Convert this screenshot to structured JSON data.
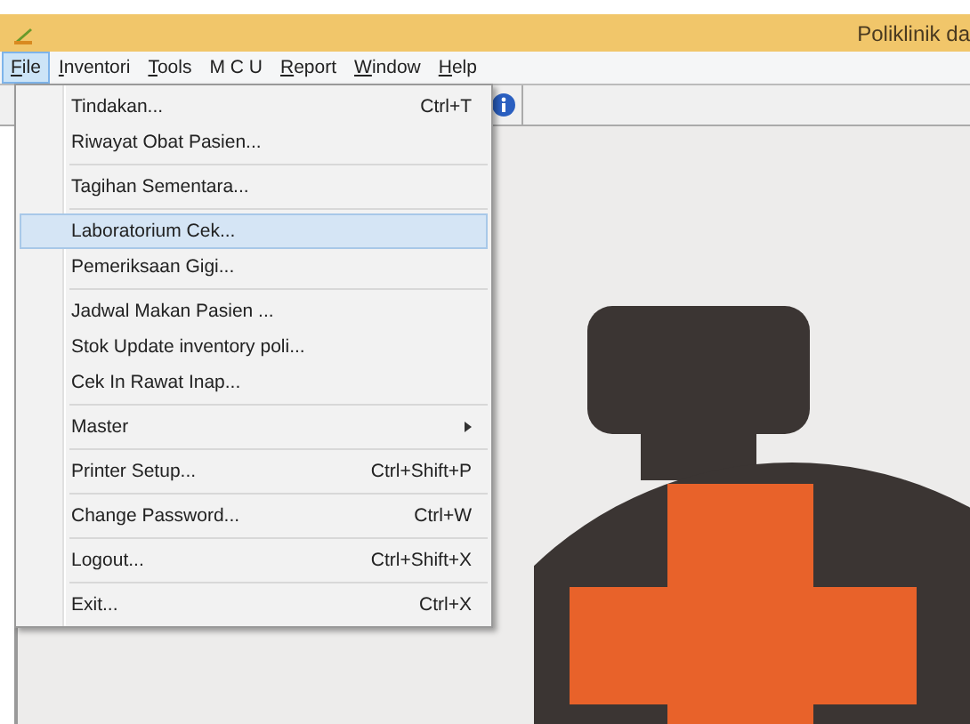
{
  "window": {
    "title": "Poliklinik da"
  },
  "menubar": [
    {
      "label": "File",
      "underline_first": true,
      "selected": true
    },
    {
      "label": "Inventori",
      "underline_first": true,
      "selected": false
    },
    {
      "label": "Tools",
      "underline_first": true,
      "selected": false
    },
    {
      "label": "M C U",
      "underline_first": false,
      "selected": false
    },
    {
      "label": "Report",
      "underline_first": true,
      "selected": false
    },
    {
      "label": "Window",
      "underline_first": true,
      "selected": false
    },
    {
      "label": "Help",
      "underline_first": true,
      "selected": false
    }
  ],
  "file_menu": [
    [
      {
        "kind": "action",
        "label": "Tindakan...",
        "shortcut": "Ctrl+T",
        "selected": false
      },
      {
        "kind": "action",
        "label": "Riwayat Obat Pasien...",
        "selected": false
      }
    ],
    [
      {
        "kind": "action",
        "label": "Tagihan Sementara...",
        "selected": false
      }
    ],
    [
      {
        "kind": "action",
        "label": "Laboratorium Cek...",
        "selected": true
      },
      {
        "kind": "action",
        "label": "Pemeriksaan Gigi...",
        "selected": false
      }
    ],
    [
      {
        "kind": "action",
        "label": "Jadwal Makan Pasien ...",
        "selected": false
      },
      {
        "kind": "action",
        "label": "Stok Update inventory poli...",
        "selected": false
      },
      {
        "kind": "action",
        "label": "Cek In Rawat Inap...",
        "selected": false
      }
    ],
    [
      {
        "kind": "submenu",
        "label": "Master",
        "selected": false
      }
    ],
    [
      {
        "kind": "action",
        "label": "Printer Setup...",
        "shortcut": "Ctrl+Shift+P",
        "selected": false
      }
    ],
    [
      {
        "kind": "action",
        "label": "Change Password...",
        "shortcut": "Ctrl+W",
        "selected": false
      }
    ],
    [
      {
        "kind": "action",
        "label": "Logout...",
        "shortcut": "Ctrl+Shift+X",
        "selected": false
      }
    ],
    [
      {
        "kind": "action",
        "label": "Exit...",
        "shortcut": "Ctrl+X",
        "selected": false
      }
    ]
  ]
}
